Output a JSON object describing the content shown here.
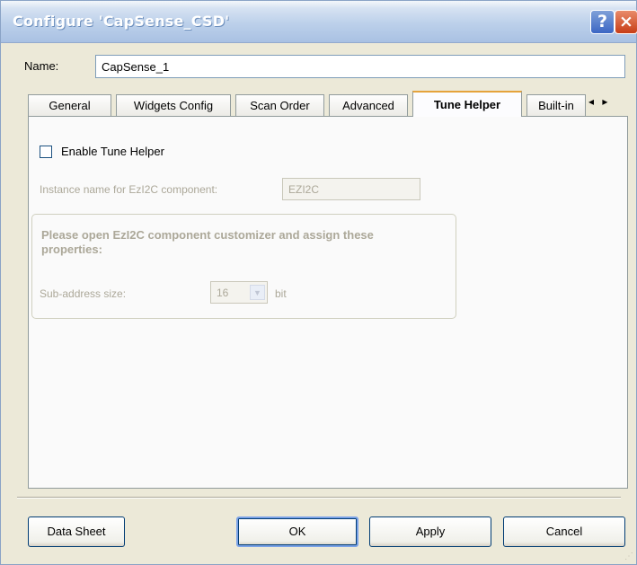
{
  "window": {
    "title": "Configure 'CapSense_CSD'",
    "help_icon": "?",
    "close_icon": "×"
  },
  "name": {
    "label": "Name:",
    "value": "CapSense_1"
  },
  "tabs": [
    {
      "label": "General",
      "selected": false
    },
    {
      "label": "Widgets Config",
      "selected": false
    },
    {
      "label": "Scan Order",
      "selected": false
    },
    {
      "label": "Advanced",
      "selected": false
    },
    {
      "label": "Tune Helper",
      "selected": true
    },
    {
      "label": "Built-in",
      "selected": false
    }
  ],
  "tab_scroll": {
    "left": "◂",
    "right": "▸"
  },
  "tune_helper": {
    "enable_label": "Enable Tune Helper",
    "enable_checked": false,
    "instance_label": "Instance name for EzI2C component:",
    "instance_value": "EZI2C",
    "group_text": "Please open EzI2C component customizer and assign these properties:",
    "subaddr_label": "Sub-address size:",
    "subaddr_value": "16",
    "subaddr_unit": "bit"
  },
  "buttons": {
    "datasheet": "Data Sheet",
    "ok": "OK",
    "apply": "Apply",
    "cancel": "Cancel"
  },
  "colors": {
    "title_bar": "#bcd0ea",
    "selected_tab_accent": "#e5a33b",
    "close_button": "#c73d17"
  }
}
